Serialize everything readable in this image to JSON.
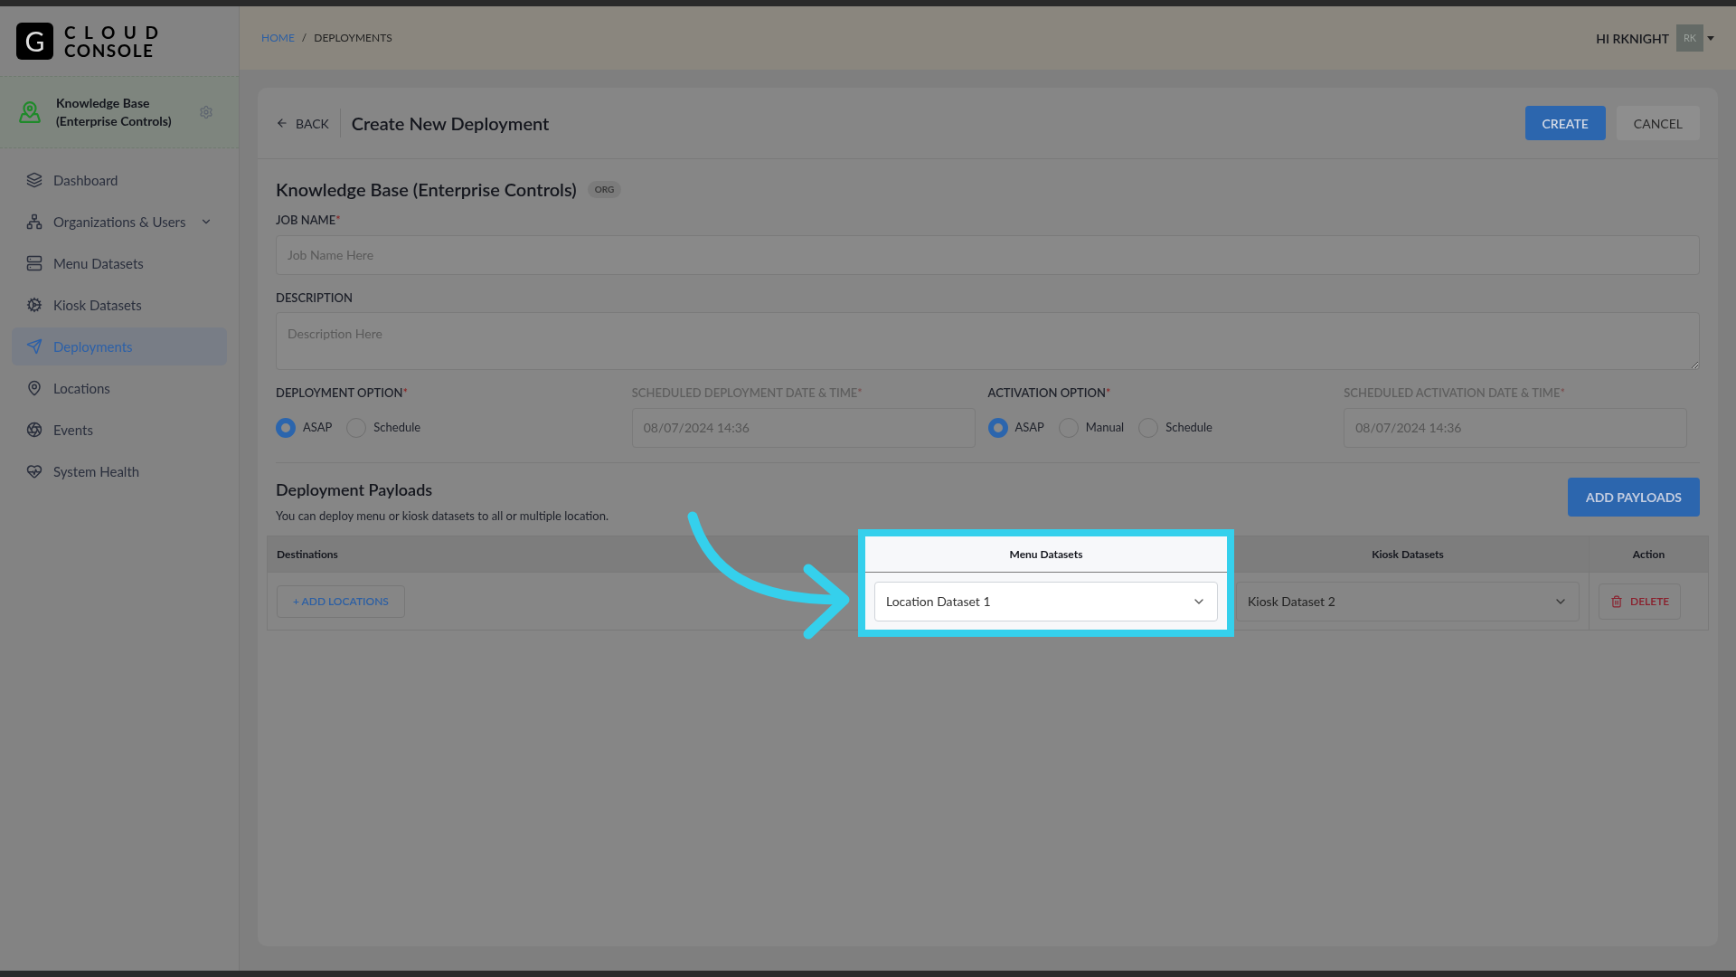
{
  "brand": {
    "letter": "G",
    "line1": "CLOUD",
    "line2": "CONSOLE"
  },
  "org": {
    "name": "Knowledge Base (Enterprise Controls)"
  },
  "sidebar": {
    "items": [
      {
        "label": "Dashboard",
        "selected": false,
        "expandable": false
      },
      {
        "label": "Organizations & Users",
        "selected": false,
        "expandable": true
      },
      {
        "label": "Menu Datasets",
        "selected": false,
        "expandable": false
      },
      {
        "label": "Kiosk Datasets",
        "selected": false,
        "expandable": false
      },
      {
        "label": "Deployments",
        "selected": true,
        "expandable": false
      },
      {
        "label": "Locations",
        "selected": false,
        "expandable": false
      },
      {
        "label": "Events",
        "selected": false,
        "expandable": false
      },
      {
        "label": "System Health",
        "selected": false,
        "expandable": false
      }
    ]
  },
  "breadcrumb": {
    "items": [
      "HOME",
      "DEPLOYMENTS"
    ],
    "separator": "/"
  },
  "user": {
    "greeting": "HI RKNIGHT",
    "initials": "RK"
  },
  "page": {
    "back": "BACK",
    "title": "Create New Deployment",
    "create": "CREATE",
    "cancel": "CANCEL"
  },
  "form": {
    "org_name": "Knowledge Base (Enterprise Controls)",
    "org_badge": "ORG",
    "job_name": {
      "label": "JOB NAME",
      "required_mark": "*",
      "placeholder": "Job Name Here"
    },
    "description": {
      "label": "DESCRIPTION",
      "placeholder": "Description Here"
    },
    "deployment_option": {
      "label": "DEPLOYMENT OPTION",
      "required_mark": "*",
      "options": [
        {
          "label": "ASAP",
          "selected": true
        },
        {
          "label": "Schedule",
          "selected": false
        }
      ]
    },
    "scheduled_deployment": {
      "label": "SCHEDULED DEPLOYMENT DATE & TIME",
      "required_mark": "*",
      "value": "08/07/2024 14:36",
      "disabled": true
    },
    "activation_option": {
      "label": "ACTIVATION OPTION",
      "required_mark": "*",
      "options": [
        {
          "label": "ASAP",
          "selected": true
        },
        {
          "label": "Manual",
          "selected": false
        },
        {
          "label": "Schedule",
          "selected": false
        }
      ]
    },
    "scheduled_activation": {
      "label": "SCHEDULED ACTIVATION DATE & TIME",
      "required_mark": "*",
      "value": "08/07/2024 14:36",
      "disabled": true
    }
  },
  "payloads": {
    "title": "Deployment Payloads",
    "subtitle": "You can deploy menu or kiosk datasets to all or multiple location.",
    "add": "ADD PAYLOADS",
    "columns": [
      {
        "label": "Destinations",
        "highlighted": false
      },
      {
        "label": "Menu Datasets",
        "highlighted": true
      },
      {
        "label": "Kiosk Datasets",
        "highlighted": false
      },
      {
        "label": "Action",
        "highlighted": false
      }
    ],
    "rows": [
      {
        "add_locations": "+ ADD LOCATIONS",
        "menu_dataset": "Location Dataset 1",
        "kiosk_dataset": "Kiosk Dataset 2",
        "action": "DELETE"
      }
    ]
  }
}
